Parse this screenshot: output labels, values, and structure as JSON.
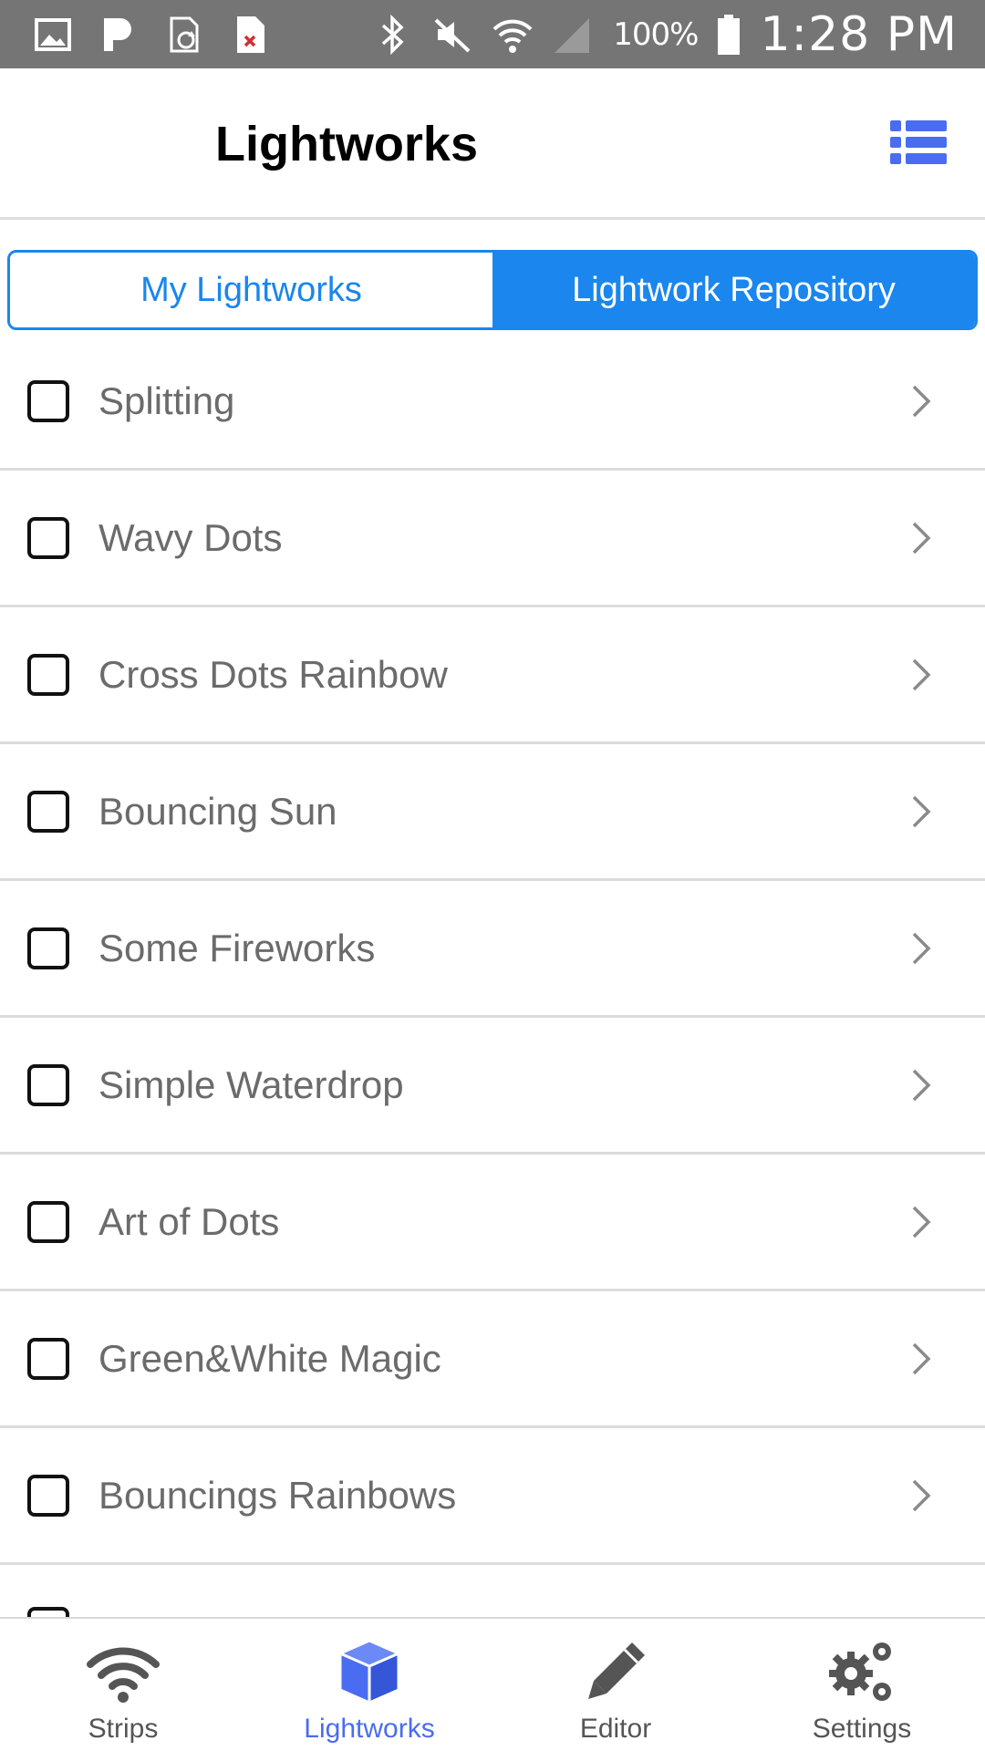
{
  "status_bar": {
    "battery": "100%",
    "time": "1:28 PM",
    "icons_left": [
      "gallery-icon",
      "pandora-icon",
      "sync-icon",
      "file-error-icon"
    ],
    "icons_right": [
      "bluetooth-icon",
      "mute-icon",
      "wifi-icon",
      "signal-icon",
      "battery-icon"
    ]
  },
  "header": {
    "title": "Lightworks",
    "action_icon": "list-view-icon"
  },
  "segment": {
    "tabs": [
      {
        "label": "My Lightworks",
        "selected": false
      },
      {
        "label": "Lightwork Repository",
        "selected": true
      }
    ]
  },
  "list": {
    "items": [
      {
        "label": "Splitting",
        "checked": false
      },
      {
        "label": "Wavy Dots",
        "checked": false
      },
      {
        "label": "Cross Dots Rainbow",
        "checked": false
      },
      {
        "label": "Bouncing Sun",
        "checked": false
      },
      {
        "label": "Some Fireworks",
        "checked": false
      },
      {
        "label": "Simple Waterdrop",
        "checked": false
      },
      {
        "label": "Art of Dots",
        "checked": false
      },
      {
        "label": "Green&White Magic",
        "checked": false
      },
      {
        "label": "Bouncings Rainbows",
        "checked": false
      }
    ]
  },
  "tabbar": {
    "tabs": [
      {
        "label": "Strips",
        "icon": "wifi-icon",
        "active": false
      },
      {
        "label": "Lightworks",
        "icon": "cube-icon",
        "active": true
      },
      {
        "label": "Editor",
        "icon": "pencil-icon",
        "active": false
      },
      {
        "label": "Settings",
        "icon": "gears-icon",
        "active": false
      }
    ]
  },
  "colors": {
    "accent": "#1a86ee",
    "tab_active": "#4a6cf0",
    "status_bar": "#757575",
    "list_text": "#6b6b6b"
  }
}
